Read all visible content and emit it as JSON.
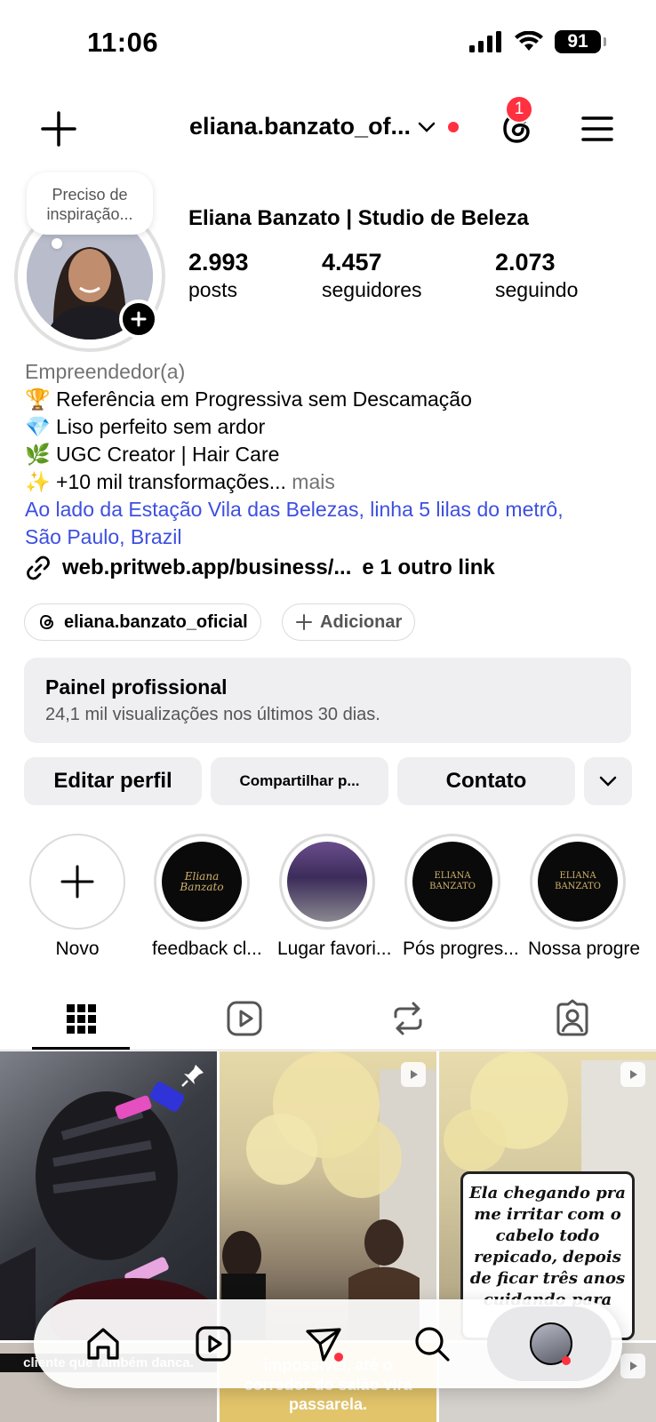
{
  "status_bar": {
    "time": "11:06",
    "battery": "91"
  },
  "header": {
    "username": "eliana.banzato_of...",
    "notification_count": "1"
  },
  "profile": {
    "note": "Preciso de inspiração...",
    "display_name": "Eliana Banzato | Studio de Beleza",
    "stats": [
      {
        "value": "2.993",
        "label": "posts"
      },
      {
        "value": "4.457",
        "label": "seguidores"
      },
      {
        "value": "2.073",
        "label": "seguindo"
      }
    ]
  },
  "bio": {
    "category": "Empreendedor(a)",
    "lines": [
      "🏆 Referência em Progressiva sem Descamação",
      "💎 Liso perfeito sem ardor",
      "🌿 UGC Creator | Hair Care",
      "✨ +10 mil transformações..."
    ],
    "more": " mais",
    "location_line1": "Ao lado da Estação Vila das Belezas, linha 5 lilas do metrô,",
    "location_line2": "São Paulo, Brazil",
    "link": "web.pritweb.app/business/...",
    "other_links": "e 1 outro link"
  },
  "chips": {
    "threads_handle": "eliana.banzato_oficial",
    "add": "Adicionar"
  },
  "panel": {
    "title": "Painel profissional",
    "subtitle": "24,1 mil visualizações nos últimos 30 dias."
  },
  "actions": {
    "edit": "Editar perfil",
    "share": "Compartilhar p...",
    "contact": "Contato"
  },
  "highlights": [
    {
      "label": "Novo"
    },
    {
      "label": "feedback cl...",
      "art": "Eliana Banzato"
    },
    {
      "label": "Lugar favori..."
    },
    {
      "label": "Pós progres...",
      "art": "ELIANA BANZATO"
    },
    {
      "label": "Nossa progre",
      "art": "ELIANA BANZATO"
    }
  ],
  "tabs": [
    "grid",
    "reels",
    "reposts",
    "tagged"
  ],
  "grid": {
    "caption_box": "Ela chegando pra me irritar com o cabelo todo repicado, depois de ficar três anos cuidando para que",
    "bottom_caption_1": "cliente que também danca.",
    "bottom_caption_2": "impossível, até o corredor do salão vira passarela."
  },
  "colors": {
    "accent_red": "#ff3040",
    "link_blue": "#3d4fe0",
    "panel_bg": "#efeff2"
  }
}
